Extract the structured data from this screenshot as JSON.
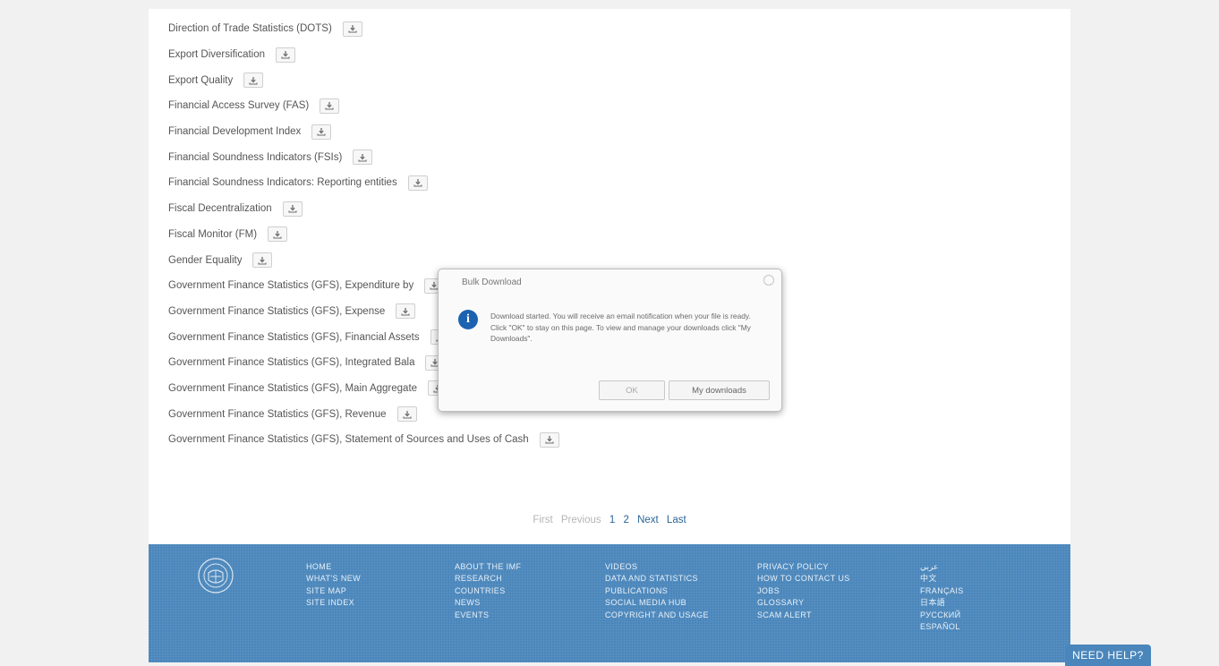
{
  "datasets": [
    {
      "label": "Direction of Trade Statistics (DOTS)"
    },
    {
      "label": "Export Diversification"
    },
    {
      "label": "Export Quality"
    },
    {
      "label": "Financial Access Survey (FAS)"
    },
    {
      "label": "Financial Development Index"
    },
    {
      "label": "Financial Soundness Indicators (FSIs)"
    },
    {
      "label": "Financial Soundness Indicators: Reporting entities"
    },
    {
      "label": "Fiscal Decentralization"
    },
    {
      "label": "Fiscal Monitor (FM)"
    },
    {
      "label": "Gender Equality"
    },
    {
      "label": "Government Finance Statistics (GFS), Expenditure by"
    },
    {
      "label": "Government Finance Statistics (GFS), Expense"
    },
    {
      "label": "Government Finance Statistics (GFS), Financial Assets"
    },
    {
      "label": "Government Finance Statistics (GFS), Integrated Bala"
    },
    {
      "label": "Government Finance Statistics (GFS), Main Aggregate"
    },
    {
      "label": "Government Finance Statistics (GFS), Revenue"
    },
    {
      "label": "Government Finance Statistics (GFS), Statement of Sources and Uses of Cash"
    }
  ],
  "download_icon": "download-icon",
  "pagination": {
    "first": "First",
    "previous": "Previous",
    "page1": "1",
    "page2": "2",
    "next": "Next",
    "last": "Last"
  },
  "dialog": {
    "title": "Bulk Download",
    "icon": "info-icon",
    "icon_glyph": "i",
    "message": "Download started. You will receive an email notification when your file is ready. Click \"OK\" to stay on this page. To view and manage your downloads click \"My Downloads\".",
    "ok_label": "OK",
    "my_downloads_label": "My downloads"
  },
  "footer": {
    "logo": "imf-seal-logo",
    "col1": [
      "HOME",
      "WHAT'S NEW",
      "SITE MAP",
      "SITE INDEX"
    ],
    "col2": [
      "ABOUT THE IMF",
      "RESEARCH",
      "COUNTRIES",
      "NEWS",
      "EVENTS"
    ],
    "col3": [
      "VIDEOS",
      "DATA AND STATISTICS",
      "PUBLICATIONS",
      "SOCIAL MEDIA HUB",
      "COPYRIGHT AND USAGE"
    ],
    "col4": [
      "PRIVACY POLICY",
      "HOW TO CONTACT US",
      "JOBS",
      "GLOSSARY",
      "SCAM ALERT"
    ],
    "col5": [
      "عربي",
      "中文",
      "FRANÇAIS",
      "日本語",
      "РУССКИЙ",
      "ESPAÑOL"
    ]
  },
  "need_help": "NEED HELP?",
  "colors": {
    "footer_bg": "#4a86bb",
    "info_blue": "#1d62b0",
    "link_blue": "#2a6496"
  }
}
